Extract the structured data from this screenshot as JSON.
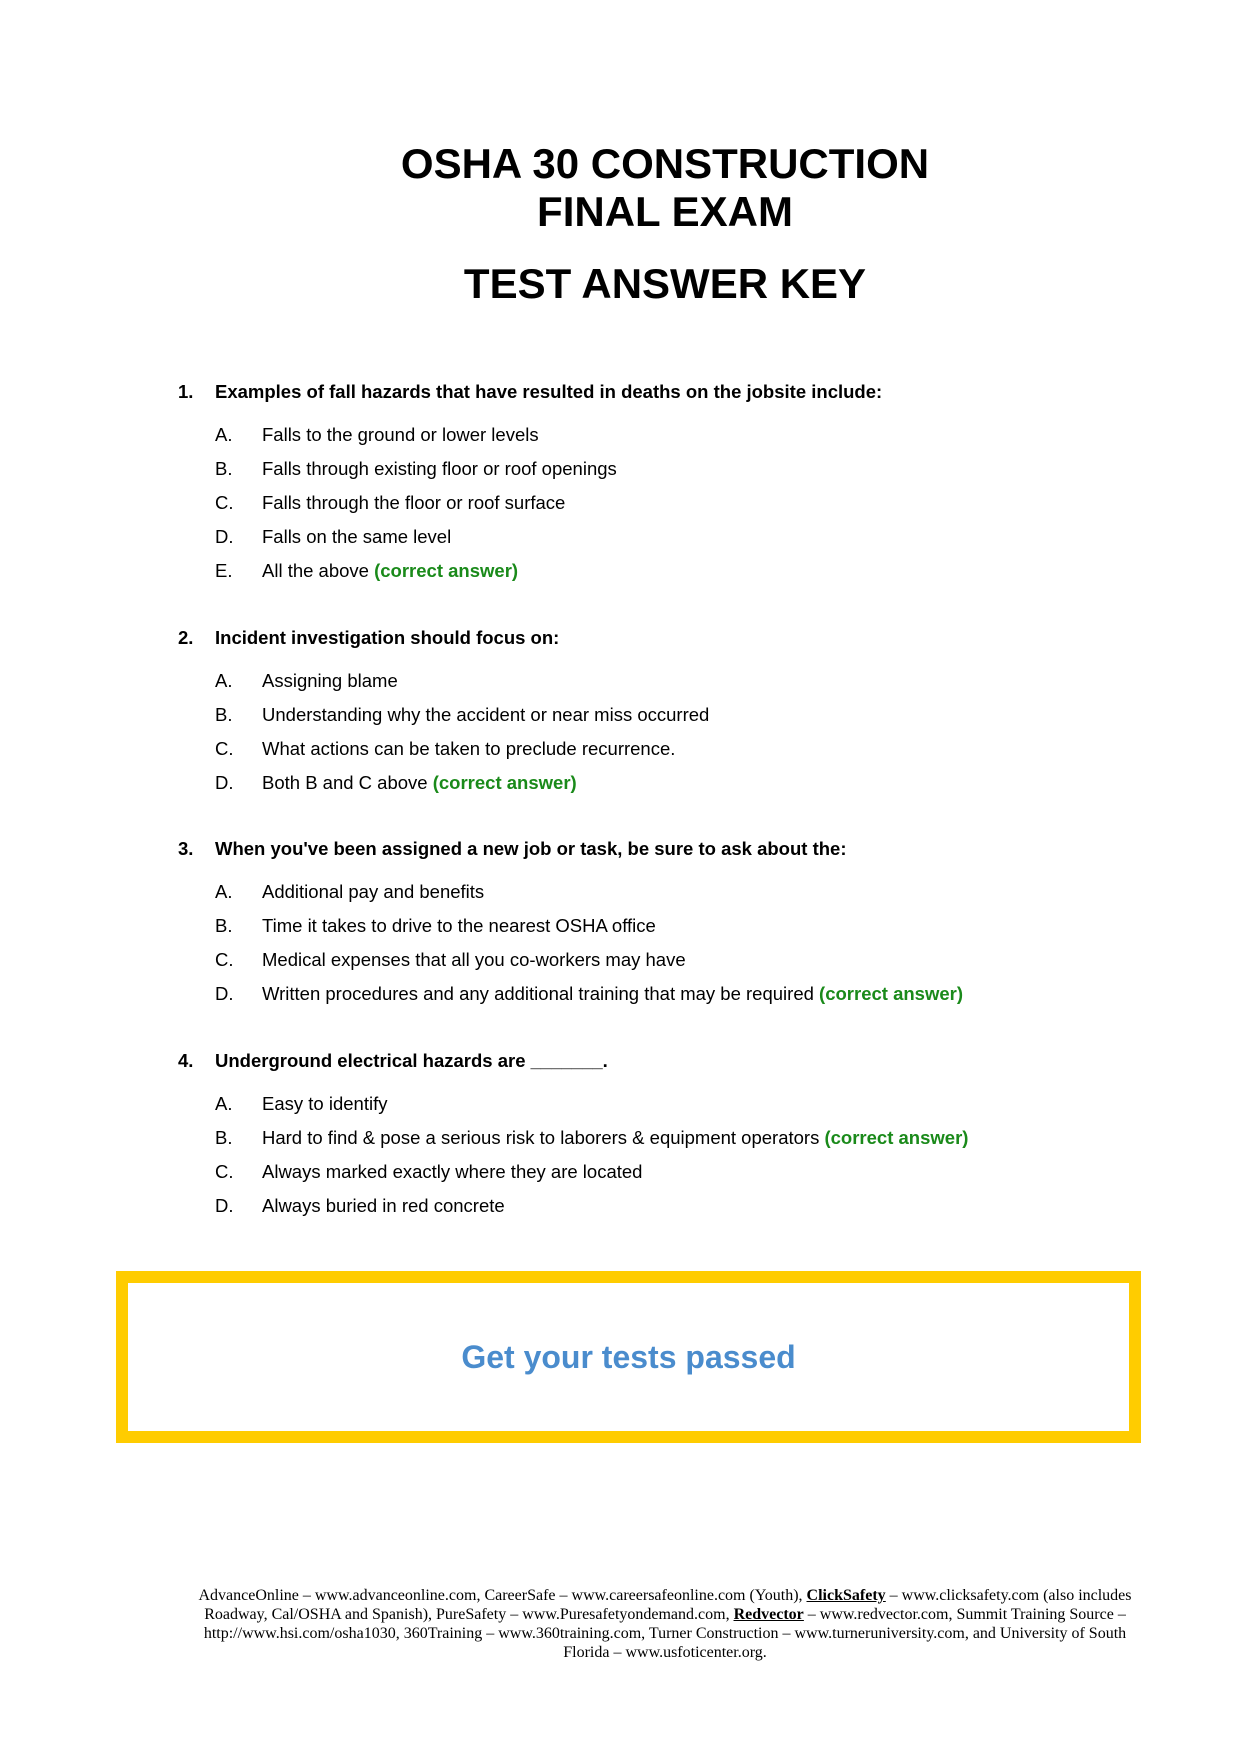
{
  "header": {
    "title_line1": "OSHA 30 CONSTRUCTION",
    "title_line2": "FINAL EXAM",
    "subtitle": "TEST ANSWER KEY"
  },
  "correct_marker": "(correct answer)",
  "colors": {
    "correct": "#1a8a1a",
    "promo_text": "#4a8ccd",
    "promo_border": "#ffcc00"
  },
  "questions": [
    {
      "number": "1.",
      "text": "Examples of fall hazards that have resulted in deaths on the jobsite include:",
      "options": [
        {
          "letter": "A.",
          "text": "Falls to the ground or lower levels"
        },
        {
          "letter": "B.",
          "text": "Falls through existing floor or roof openings"
        },
        {
          "letter": "C.",
          "text": "Falls through the floor or roof surface"
        },
        {
          "letter": "D.",
          "text": "Falls on the same level"
        },
        {
          "letter": "E.",
          "text": "All the above",
          "correct": "(correct answer)"
        }
      ]
    },
    {
      "number": "2.",
      "text": "Incident investigation should focus on:",
      "options": [
        {
          "letter": "A.",
          "text": "Assigning blame"
        },
        {
          "letter": "B.",
          "text": "Understanding why the accident or near miss occurred"
        },
        {
          "letter": "C.",
          "text": "What actions can be taken to preclude recurrence."
        },
        {
          "letter": "D.",
          "text": "Both B and C above",
          "correct": "(correct answer)"
        }
      ]
    },
    {
      "number": "3.",
      "text": "When you've been assigned a new job or task, be sure to ask about the:",
      "options": [
        {
          "letter": "A.",
          "text": "Additional pay and benefits"
        },
        {
          "letter": "B.",
          "text": "Time it takes to drive to the nearest OSHA office"
        },
        {
          "letter": "C.",
          "text": "Medical expenses that all you co-workers may have"
        },
        {
          "letter": "D.",
          "text": "Written procedures and any additional training that may be required",
          "correct": "(correct answer)"
        }
      ]
    },
    {
      "number": "4.",
      "text": "Underground electrical hazards are _______.",
      "options": [
        {
          "letter": "A.",
          "text": "Easy to identify"
        },
        {
          "letter": "B.",
          "text": "Hard to find & pose a serious risk to laborers & equipment operators",
          "correct": "(correct answer)"
        },
        {
          "letter": "C.",
          "text": "Always marked exactly where they are located"
        },
        {
          "letter": "D.",
          "text": "Always buried in red concrete"
        }
      ]
    }
  ],
  "promo": {
    "text": "Get your tests passed"
  },
  "footer": {
    "part1": "AdvanceOnline – www.advanceonline.com, CareerSafe – www.careersafeonline.com (Youth), ",
    "link1": "ClickSafety",
    "part2": " – www.clicksafety.com (also includes Roadway, Cal/OSHA and Spanish), PureSafety – www.Puresafetyondemand.com, ",
    "link2": "Redvector",
    "part3": " – www.redvector.com, Summit Training Source – http://www.hsi.com/osha1030, 360Training – www.360training.com, Turner Construction – www.turneruniversity.com, and University of South Florida – www.usfoticenter.org."
  }
}
